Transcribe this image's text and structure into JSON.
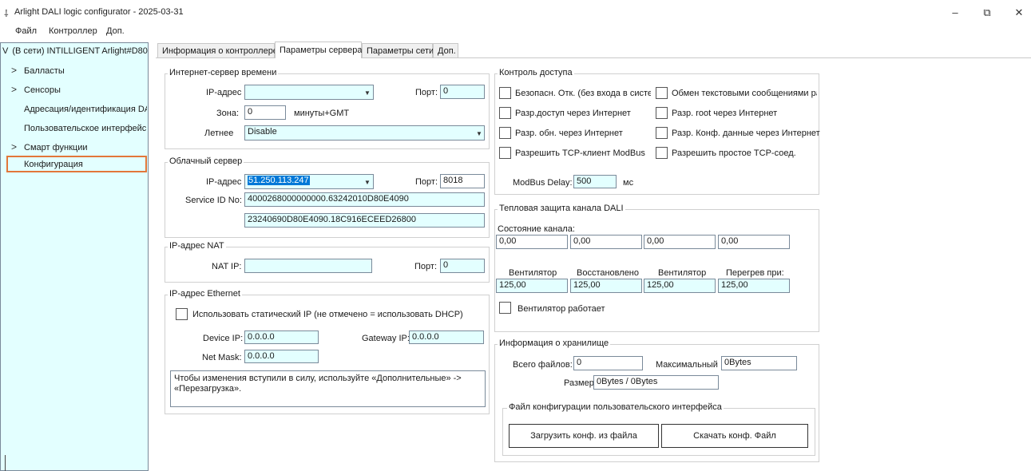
{
  "window": {
    "title": "Arlight DALI logic configurator - 2025-03-31",
    "minimize": "–",
    "restore": "⧉",
    "close": "✕"
  },
  "menu": [
    "Файл",
    "Контроллер",
    "Доп."
  ],
  "tree": {
    "root": "(В сети) INTILLIGENT Arlight#D80",
    "root_chevron": "V",
    "items": [
      {
        "label": "Балласты",
        "expandable": true
      },
      {
        "label": "Сенсоры",
        "expandable": true
      },
      {
        "label": "Адресация/идентификация DALI",
        "expandable": false
      },
      {
        "label": "Пользовательское интерфейс",
        "expandable": false
      },
      {
        "label": "Смарт функции",
        "expandable": true
      },
      {
        "label": "Конфигурация",
        "expandable": false
      }
    ],
    "chevron": ">"
  },
  "tabs": [
    "Информация о контроллере",
    "Параметры сервера",
    "Параметры сети",
    "Доп."
  ],
  "time_server": {
    "title": "Интернет-сервер времени",
    "ip_label": "IP-адрес",
    "ip_value": "",
    "port_label": "Порт:",
    "port_value": "0",
    "zone_label": "Зона:",
    "zone_value": "0",
    "zone_unit": "минуты+GMT",
    "summer_label": "Летнее",
    "summer_value": "Disable"
  },
  "cloud": {
    "title": "Облачный сервер",
    "ip_label": "IP-адрес",
    "ip_value": "51.250.113.247",
    "port_label": "Порт:",
    "port_value": "8018",
    "sid_label": "Service ID No:",
    "sid_value1": "4000268000000000.63242010D80E4090",
    "sid_value2": "23240690D80E4090.18C916ECEED26800"
  },
  "nat": {
    "title": "IP-адрес NAT",
    "ip_label": "NAT IP:",
    "ip_value": "",
    "port_label": "Порт:",
    "port_value": "0"
  },
  "ethernet": {
    "title": "IP-адрес Ethernet",
    "static_label": "Использовать статический IP (не отмечено = использовать DHCP)",
    "device_ip_label": "Device IP:",
    "device_ip": "0.0.0.0",
    "gateway_label": "Gateway IP:",
    "gateway_ip": "0.0.0.0",
    "mask_label": "Net Mask:",
    "mask": "0.0.0.0",
    "note": "Чтобы изменения вступили в силу, используйте «Дополнительные» -> «Перезагрузка»."
  },
  "access": {
    "title": "Контроль доступа",
    "checks": [
      "Безопасн. Отк. (без входа в систем",
      "Обмен текстовыми сообщениями раз",
      "Разр.доступ через Интернет",
      "Разр. root через Интернет",
      "Разр. обн. через Интернет",
      "Разр. Конф. данные через Интернет",
      "Разрешить TCP-клиент ModBus",
      "Разрешить простое TCP-соед."
    ],
    "modbus_label": "ModBus Delay:",
    "modbus_value": "500",
    "modbus_unit": "мс"
  },
  "thermal": {
    "title": "Тепловая защита канала DALI",
    "state_label": "Состояние канала:",
    "states": [
      "0,00",
      "0,00",
      "0,00",
      "0,00"
    ],
    "col_labels": [
      "Вентилятор",
      "Восстановлено",
      "Вентилятор",
      "Перегрев при:"
    ],
    "values": [
      "125,00",
      "125,00",
      "125,00",
      "125,00"
    ],
    "fan_label": "Вентилятор работает"
  },
  "storage": {
    "title": "Информация о хранилище",
    "files_label": "Всего файлов:",
    "files_value": "0",
    "max_label": "Максимальный",
    "max_value": "0Bytes",
    "size_label": "Размер",
    "size_value": "0Bytes / 0Bytes",
    "ui_title": "Файл конфигурации пользовательского интерфейса",
    "load_btn": "Загрузить конф. из файла",
    "download_btn": "Скачать конф. Файл"
  }
}
